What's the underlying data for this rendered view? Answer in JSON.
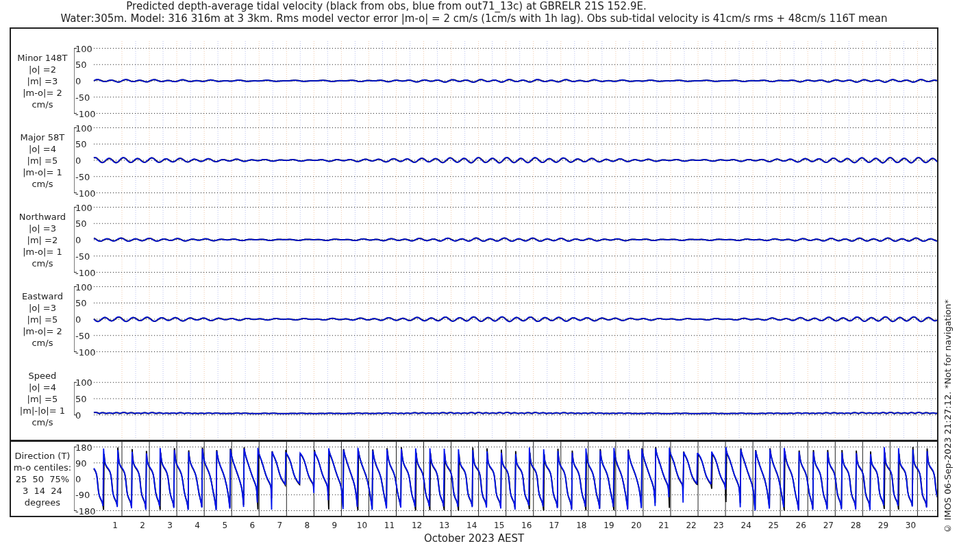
{
  "title": [
    "Predicted depth-average tidal velocity (black from obs, blue from out71_13c) at GBRELR 21S 152.9E.",
    "Water:305m. Model: 316 316m at 3 3km. Rms model vector error |m-o| = 2 cm/s (1cm/s with 1h lag). Obs sub-tidal velocity is 41cm/s rms + 48cm/s 116T mean"
  ],
  "panels": [
    {
      "kind": "velocity",
      "label": [
        "Minor 148T",
        "|o| =2",
        "|m| =3",
        "|m-o|= 2",
        "cm/s"
      ],
      "yticks": [
        "100",
        "50",
        "0",
        "-50",
        "-100"
      ]
    },
    {
      "kind": "velocity",
      "label": [
        "Major 58T",
        "|o| =4",
        "|m| =5",
        "|m-o|= 1",
        "cm/s"
      ],
      "yticks": [
        "100",
        "50",
        "0",
        "-50",
        "-100"
      ]
    },
    {
      "kind": "velocity",
      "label": [
        "Northward",
        "|o| =3",
        "|m| =2",
        "|m-o|= 1",
        "cm/s"
      ],
      "yticks": [
        "100",
        "50",
        "0",
        "-50",
        "-100"
      ]
    },
    {
      "kind": "velocity",
      "label": [
        "Eastward",
        "|o| =3",
        "|m| =5",
        "|m-o|= 2",
        "cm/s"
      ],
      "yticks": [
        "100",
        "50",
        "0",
        "-50",
        "-100"
      ]
    },
    {
      "kind": "speed",
      "label": [
        "Speed",
        "|o| =4",
        "|m| =5",
        "|m|-|o|= 1",
        "cm/s"
      ],
      "yticks": [
        "100",
        "50",
        "0"
      ]
    }
  ],
  "direction_panel": {
    "label": [
      "Direction (T)",
      "m-o centiles:",
      "25  50  75%",
      "3  14  24",
      "degrees"
    ],
    "yticks": [
      "180",
      "90",
      "0",
      "-90",
      "-180"
    ]
  },
  "days": [
    "1",
    "2",
    "3",
    "4",
    "5",
    "6",
    "7",
    "8",
    "9",
    "10",
    "11",
    "12",
    "13",
    "14",
    "15",
    "16",
    "17",
    "18",
    "19",
    "20",
    "21",
    "22",
    "23",
    "24",
    "25",
    "26",
    "27",
    "28",
    "29",
    "30"
  ],
  "xlabel": "October 2023 AEST",
  "credit": "© IMOS 06-Sep-2023 21:27:12. *Not for navigation*"
}
